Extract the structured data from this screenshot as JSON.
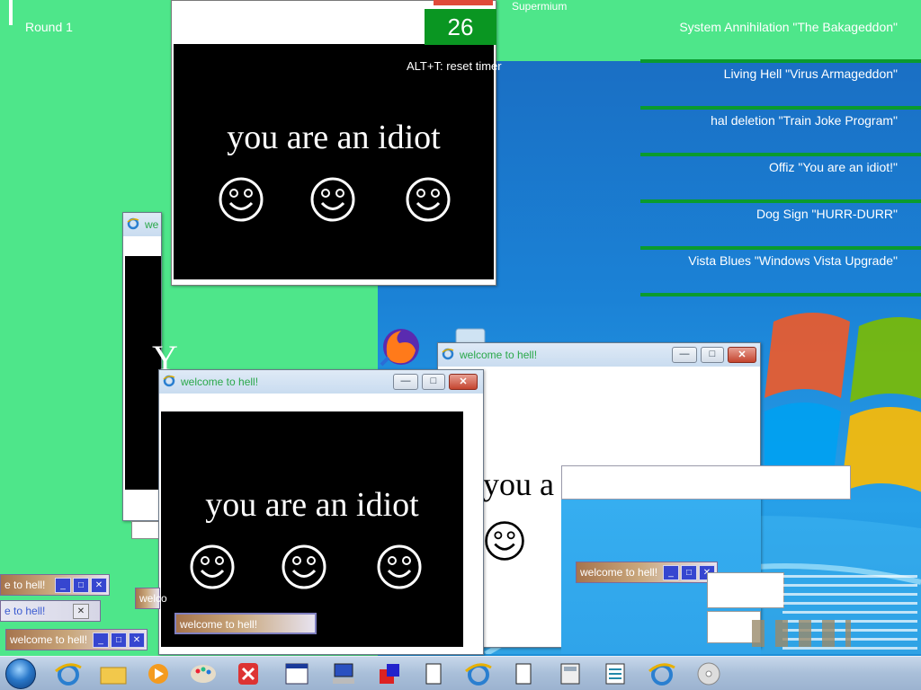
{
  "round_label": "Round 1",
  "supermium_label": "Supermium",
  "reset_hint": "ALT+T: reset timer",
  "timer_value": "26",
  "ranklist": [
    "System Annihilation \"The Bakageddon\"",
    "Living Hell \"Virus Armageddon\"",
    "hal deletion \"Train Joke Program\"",
    "Offiz \"You are an idiot!\"",
    "Dog Sign \"HURR-DURR\"",
    "Vista Blues \"Windows Vista Upgrade\""
  ],
  "windows": {
    "top": {
      "idiot": "you are an idiot"
    },
    "front": {
      "title": "welcome to hell!",
      "idiot": "you are an idiot",
      "field": "welcome to hell!"
    },
    "right": {
      "title": "welcome to hell!",
      "idiot": "you a"
    },
    "back_left": {
      "title": "we",
      "glyph": "Y"
    }
  },
  "mini_dialogs": [
    {
      "title": "e to hell!"
    },
    {
      "title": "e to hell!"
    },
    {
      "title": "welcome to hell!"
    },
    {
      "title": "welco"
    },
    {
      "title": "welcome to hell!"
    }
  ],
  "icons": {
    "ie": "internet-explorer-icon",
    "firefox": "firefox-icon",
    "recycle": "recycle-bin-icon",
    "start": "windows-start-icon"
  },
  "colors": {
    "desktop_green": "#4ee68a",
    "timer_green": "#0a9622",
    "rank_bar": "#0a9b2e"
  }
}
